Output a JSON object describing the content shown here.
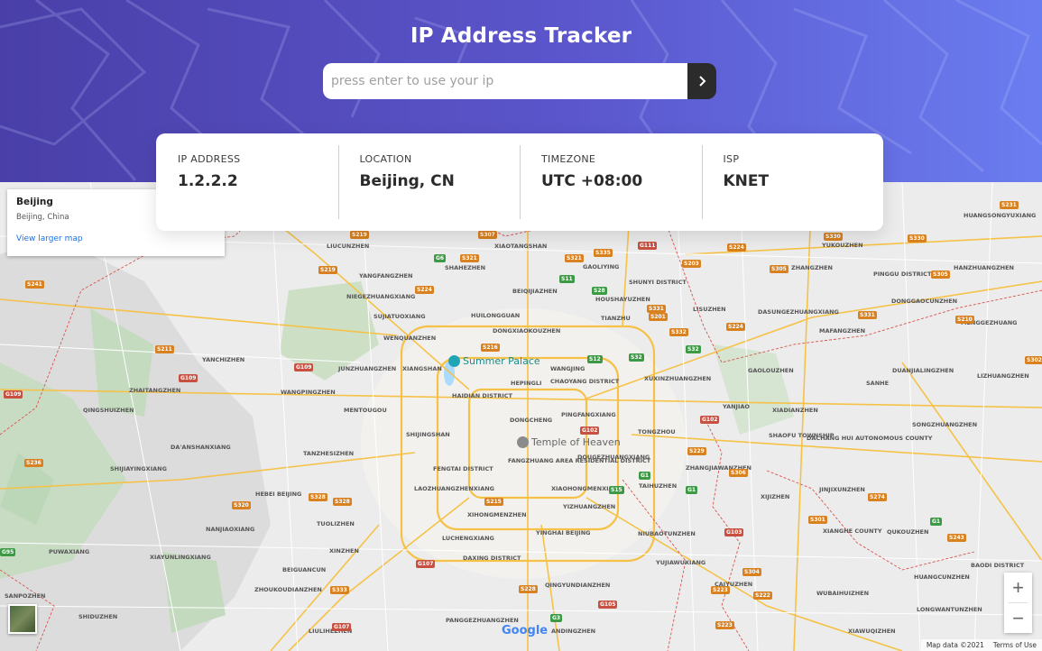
{
  "header": {
    "title": "IP Address Tracker",
    "search_placeholder": "press enter to use your ip",
    "search_value": ""
  },
  "info": [
    {
      "label": "IP ADDRESS",
      "value": "1.2.2.2"
    },
    {
      "label": "LOCATION",
      "value": "Beijing, CN"
    },
    {
      "label": "TIMEZONE",
      "value": "UTC +08:00"
    },
    {
      "label": "ISP",
      "value": "KNET"
    }
  ],
  "map": {
    "place_card": {
      "name": "Beijing",
      "address": "Beijing, China",
      "link": "View larger map"
    },
    "poi": {
      "summer_palace": "Summer Palace",
      "temple_of_heaven": "Temple of Heaven"
    },
    "labels": {
      "l1": "LIUCUNZHEN",
      "l2": "XIAOTANGSHAN",
      "l3": "SHAHEZHEN",
      "l4": "YANGFANGZHEN",
      "l5": "NIEGEZHUANGXIANG",
      "l6": "SUJIATUOXIANG",
      "l7": "WENQUANZHEN",
      "l8": "HUILONGGUAN",
      "l9": "DONGXIAOKOUZHEN",
      "l10": "BEIQIJIAZHEN",
      "l11": "GAOLIYING",
      "l12": "HOUSHAYUZHEN",
      "l13": "SHUNYI DISTRICT",
      "l14": "TIANZHU",
      "l15": "LISUZHEN",
      "l16": "YUKOUZHEN",
      "l17": "ZHANGZHEN",
      "l18": "PINGGU DISTRICT",
      "l19": "DONGGAOCUNZHEN",
      "l20": "DASUNGEZHUANGXIANG",
      "l21": "MAFANGZHEN",
      "l22": "YANCHIZHEN",
      "l23": "JUNZHUANGZHEN",
      "l24": "XIANGSHAN",
      "l25": "WANGJING",
      "l26": "XUXINZHUANGZHEN",
      "l27": "GAOLOUZHEN",
      "l28": "DUANJIALINGZHEN",
      "l29": "LIZHUANGZHEN",
      "l30": "ZHAITANGZHEN",
      "l31": "QINGSHUIZHEN",
      "l32": "WANGPINGZHEN",
      "l33": "MENTOUGOU",
      "l34": "HAIDIAN DISTRICT",
      "l35": "HEPINGLI",
      "l36": "CHAOYANG DISTRICT",
      "l37": "PINGFANGXIANG",
      "l38": "YANJIAO",
      "l39": "XIADIANZHEN",
      "l40": "SANHE",
      "l41": "DA'ANSHANXIANG",
      "l42": "TANZHESIZHEN",
      "l43": "SHIJINGSHAN",
      "l44": "DONGCHENG",
      "l45": "TONGZHOU",
      "l46": "SHAOFU TOWNSHIP",
      "l47": "DACHANG HUI AUTONOMOUS COUNTY",
      "l48": "SHIJIAYINGXIANG",
      "l49": "FENGTAI DISTRICT",
      "l50": "FANGZHUANG AREA RESIDENTIAL DISTRICT",
      "l51": "DOUGEZHUANGXIANG",
      "l52": "ZHANGJIAWANZHEN",
      "l53": "HEBEI BEIJING",
      "l54": "LAOZHUANGZHENXIANG",
      "l55": "XIAOHONGMENXIANG",
      "l56": "TAIHUZHEN",
      "l57": "XIJIZHEN",
      "l58": "JINJIXUNZHEN",
      "l59": "XIANGHE COUNTY",
      "l60": "NANJIAOXIANG",
      "l61": "TUOLIZHEN",
      "l62": "XIHONGMENZHEN",
      "l63": "YIZHUANGZHEN",
      "l64": "PUWAXIANG",
      "l65": "XIAYUNLINGXIANG",
      "l66": "XINZHEN",
      "l67": "LUCHENGXIANG",
      "l68": "YINGHAI BEIJING",
      "l69": "NIUBAOTUNZHEN",
      "l70": "QUKOUZHEN",
      "l71": "BEIGUANCUN",
      "l72": "DAXING DISTRICT",
      "l73": "YUJIAWUXIANG",
      "l74": "BAODI DISTRICT",
      "l75": "ZHOUKOUDIANZHEN",
      "l76": "QINGYUNDIANZHEN",
      "l77": "CAIYUZHEN",
      "l78": "WUBAIHUIZHEN",
      "l79": "SANPOZHEN",
      "l80": "SHIDUZHEN",
      "l81": "LIULIHEZHEN",
      "l82": "PANGGEZHUANGZHEN",
      "l83": "ANDINGZHEN",
      "l84": "XIAWUQIZHEN",
      "l85": "HUANGSONGYUXIANG",
      "l86": "HANZHUANGZHEN",
      "l87": "MENGGEZHUANG",
      "l88": "SONGZHUANGZHEN",
      "l89": "HUANGCUNZHEN",
      "l90": "LONGWANTUNZHEN"
    },
    "shields": {
      "s1": "S219",
      "s2": "S307",
      "s3": "S321",
      "s4": "G6",
      "s5": "S321",
      "s6": "S335",
      "s7": "G111",
      "s8": "S224",
      "s9": "S330",
      "s10": "S330",
      "s11": "S219",
      "s12": "S224",
      "s13": "S11",
      "s14": "S28",
      "s15": "S203",
      "s16": "S305",
      "s17": "S305",
      "s18": "S241",
      "s19": "S331",
      "s20": "S201",
      "s21": "S224",
      "s22": "S332",
      "s23": "S331",
      "s24": "S216",
      "s25": "S211",
      "s26": "G109",
      "s27": "G109",
      "s28": "G109",
      "s29": "S12",
      "s30": "S32",
      "s31": "S32",
      "s32": "S302",
      "s33": "G102",
      "s34": "G102",
      "s35": "S236",
      "s36": "S229",
      "s37": "S306",
      "s38": "G1",
      "s39": "G1",
      "s40": "S15",
      "s41": "S328",
      "s42": "S328",
      "s43": "S320",
      "s44": "S215",
      "s45": "S274",
      "s46": "S301",
      "s47": "G103",
      "s48": "G107",
      "s49": "S304",
      "s50": "S333",
      "s51": "S228",
      "s52": "S223",
      "s53": "S222",
      "s54": "G107",
      "s55": "G105",
      "s56": "G3",
      "s57": "S223",
      "s58": "G95",
      "s59": "S210",
      "s60": "S243",
      "s61": "G1",
      "s62": "S231"
    },
    "zoom_in": "+",
    "zoom_out": "−",
    "google": "Google",
    "map_data": "Map data ©2021",
    "terms": "Terms of Use"
  },
  "colors": {
    "header_start": "#4a3fa8",
    "header_end": "#6a7df0",
    "button_bg": "#2b2b2b",
    "link": "#1a73e8"
  },
  "icons": {
    "search_button": "chevron-right-icon",
    "summer_palace": "camera-pin-icon",
    "temple": "temple-pin-icon"
  }
}
